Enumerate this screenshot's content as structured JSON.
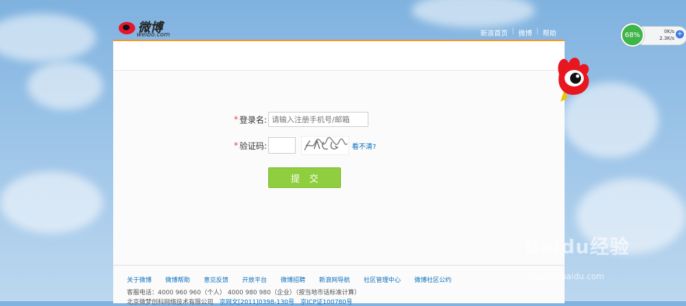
{
  "header": {
    "logo_text": "微博",
    "logo_sub": "weibo.com",
    "nav": [
      "新浪首页",
      "微博",
      "帮助"
    ]
  },
  "form": {
    "login_label": "登录名:",
    "login_placeholder": "请输入注册手机号/邮箱",
    "captcha_label": "验证码:",
    "captcha_refresh": "看不清?",
    "submit_label": "提交",
    "required_mark": "*"
  },
  "footer": {
    "links": [
      "关于微博",
      "微博帮助",
      "意见反馈",
      "开放平台",
      "微博招聘",
      "新浪网导航",
      "社区管理中心",
      "微博社区公约"
    ],
    "hotline": "客服电话：4000 960 960（个人） 4000 980 980（企业）（按当地市话标准计算）",
    "company": "北京微梦创科网络技术有限公司",
    "license1": "京网文[2011]0398-130号",
    "license2": "京ICP证100780号"
  },
  "speed_widget": {
    "percent": "68%",
    "up": "0K/s",
    "down": "2.3K/s"
  },
  "watermark": {
    "brand": "Baidu经验",
    "url": "jingyan.baidu.com"
  },
  "colors": {
    "accent_orange": "#f7941d",
    "submit_green": "#8fce3f",
    "link_blue": "#0a6ebd"
  }
}
